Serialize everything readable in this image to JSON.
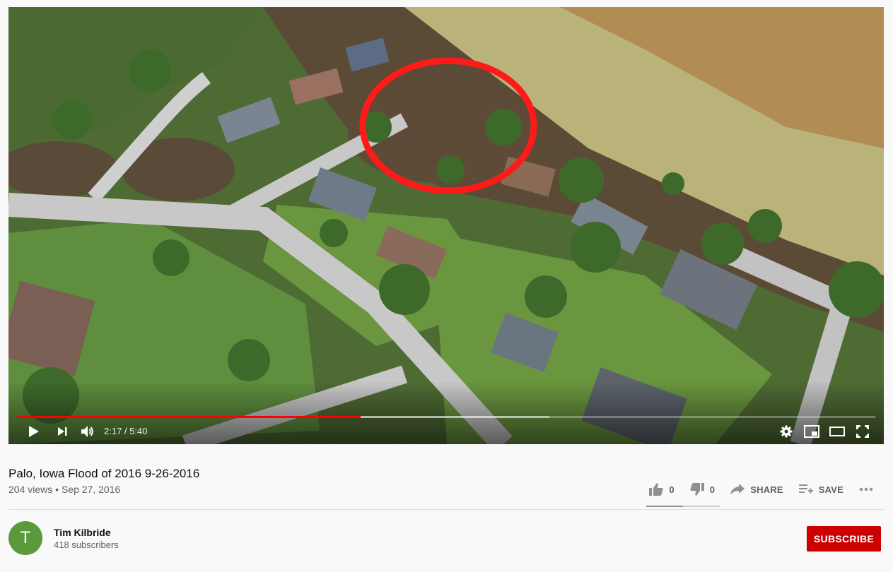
{
  "video": {
    "title": "Palo, Iowa Flood of 2016 9-26-2016",
    "views": "204 views",
    "separator": "•",
    "date": "Sep 27, 2016",
    "time_display": "2:17 / 5:40",
    "progress_played": 0.4,
    "progress_buffered": 0.62
  },
  "actions": {
    "like_count": "0",
    "dislike_count": "0",
    "share_label": "SHARE",
    "save_label": "SAVE",
    "likes_ratio": 0.5
  },
  "channel": {
    "avatar_letter": "T",
    "name": "Tim Kilbride",
    "subscribers": "418 subscribers",
    "subscribe_label": "SUBSCRIBE"
  },
  "colors": {
    "played": "#ff0000",
    "subscribe": "#cc0000",
    "avatar": "#5a9a3a",
    "annotation_circle": "#ff1a1a"
  },
  "icons": [
    "play-icon",
    "next-icon",
    "volume-icon",
    "settings-icon",
    "miniplayer-icon",
    "theater-icon",
    "fullscreen-icon",
    "like-icon",
    "dislike-icon",
    "share-icon",
    "save-icon",
    "more-icon"
  ]
}
